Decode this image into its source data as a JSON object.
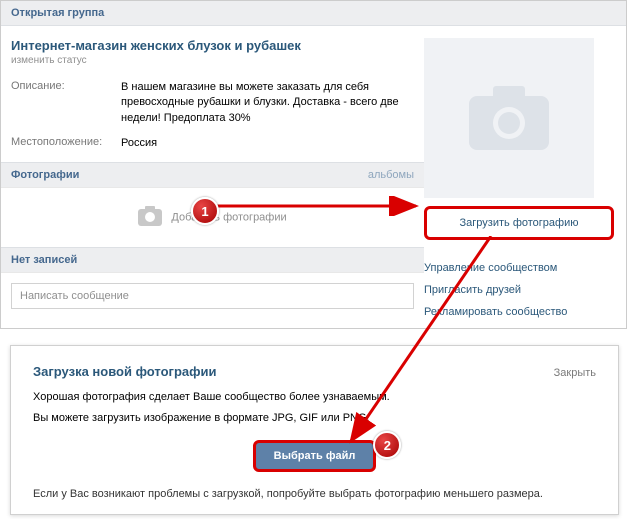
{
  "header": {
    "type_label": "Открытая группа"
  },
  "group": {
    "title": "Интернет-магазин женских блузок и рубашек",
    "change_status": "изменить статус",
    "info": {
      "description_label": "Описание:",
      "description_value": "В нашем магазине вы можете заказать для себя превосходные рубашки и блузки. Доставка - всего две недели! Предоплата 30%",
      "location_label": "Местоположение:",
      "location_value": "Россия"
    }
  },
  "photos": {
    "section_title": "Фотографии",
    "albums_link": "альбомы",
    "add_text": "Добавить фотографии"
  },
  "posts": {
    "section_title": "Нет записей",
    "write_placeholder": "Написать сообщение"
  },
  "sidebar": {
    "upload_button": "Загрузить фотографию",
    "links": [
      "Управление сообществом",
      "Пригласить друзей",
      "Рекламировать сообщество"
    ]
  },
  "modal": {
    "title": "Загрузка новой фотографии",
    "close": "Закрыть",
    "line1": "Хорошая фотография сделает Ваше сообщество более узнаваемым.",
    "line2": "Вы можете загрузить изображение в формате JPG, GIF или PNG.",
    "choose_button": "Выбрать файл",
    "footer": "Если у Вас возникают проблемы с загрузкой, попробуйте выбрать фотографию меньшего размера."
  },
  "annotations": {
    "badge1": "1",
    "badge2": "2"
  }
}
